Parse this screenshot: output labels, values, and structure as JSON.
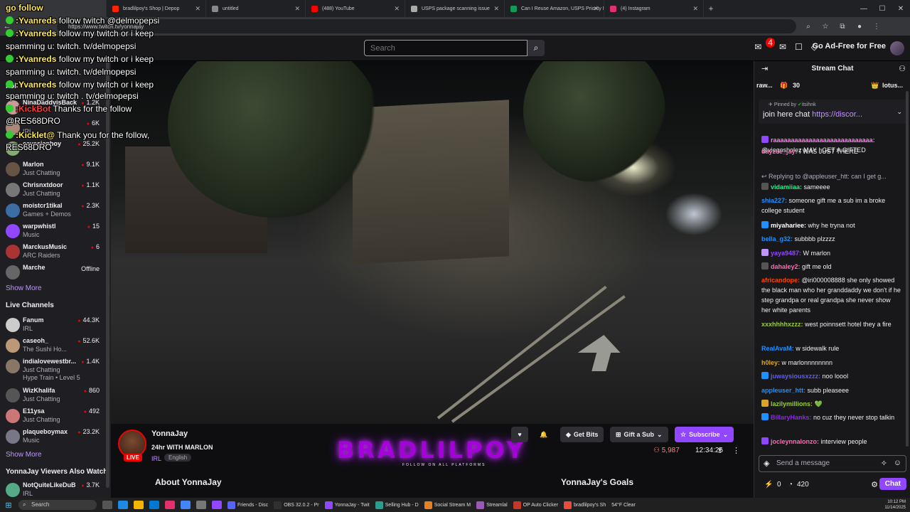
{
  "browser": {
    "tabs": [
      {
        "title": "bradlilpoy's Shop | Depop",
        "color": "#ff2300"
      },
      {
        "title": "untitled",
        "color": "#888888"
      },
      {
        "title": "(488) YouTube",
        "color": "#ff0000"
      },
      {
        "title": "USPS package scanning issue",
        "color": "#aaaaaa"
      },
      {
        "title": "Can I Reuse Amazon, USPS Priority M",
        "color": "#0f9d58"
      },
      {
        "title": "(4) Instagram",
        "color": "#e1306c"
      }
    ],
    "url": "https://www.twitch.tv/yonnajay"
  },
  "topnav": {
    "search_placeholder": "Search",
    "notif_count": "4",
    "adfree_label": "Go Ad-Free for Free"
  },
  "sidebar": {
    "followed_heading": "Fol",
    "followed": [
      {
        "name": "NinaDaddyisBack",
        "category": "",
        "count": "1.2K",
        "color": "#c99"
      },
      {
        "name": "",
        "category": "IRL",
        "count": "6K",
        "color": "#a87"
      },
      {
        "name": "cavasianboy",
        "category": "",
        "count": "25.2K",
        "color": "#8a7"
      },
      {
        "name": "Marlon",
        "category": "Just Chatting",
        "count": "9.1K",
        "color": "#654"
      },
      {
        "name": "Chrisnxtdoor",
        "category": "Just Chatting",
        "count": "1.1K",
        "color": "#777"
      },
      {
        "name": "moistcr1tikal",
        "category": "Games + Demos",
        "count": "2.3K",
        "color": "#3a6ea5"
      },
      {
        "name": "warpwhistl",
        "category": "Music",
        "count": "15",
        "color": "#9147ff"
      },
      {
        "name": "MarckusMusic",
        "category": "ARC Raiders",
        "count": "6",
        "color": "#a33"
      },
      {
        "name": "Marche",
        "category": "",
        "count": "",
        "offline": "Offline",
        "color": "#666"
      }
    ],
    "show_more_1": "Show More",
    "live_heading": "Live Channels",
    "live": [
      {
        "name": "Fanum",
        "category": "IRL",
        "count": "44.3K",
        "color": "#ccc"
      },
      {
        "name": "caseoh_",
        "category": "The Sushi Ho...",
        "count": "52.6K",
        "color": "#b97"
      },
      {
        "name": "indialovewestbr...",
        "category": "Just Chatting",
        "count": "1.4K",
        "color": "#876",
        "sub": "Hype Train • Level 5"
      },
      {
        "name": "WizKhalifa",
        "category": "Just Chatting",
        "count": "860",
        "color": "#555"
      },
      {
        "name": "E11ysa",
        "category": "Just Chatting",
        "count": "492",
        "color": "#c77"
      },
      {
        "name": "plaqueboymax",
        "category": "Music",
        "count": "23.2K",
        "color": "#778"
      }
    ],
    "show_more_2": "Show More",
    "also_watch_heading": "YonnaJay Viewers Also Watch",
    "also_watch": [
      {
        "name": "NotQuiteLikeDuB",
        "category": "IRL",
        "count": "3.7K",
        "color": "#5a8"
      }
    ]
  },
  "overlay_chat": [
    {
      "user": "go follow",
      "text": "",
      "plain": true
    },
    {
      "user": ":Yvanreds",
      "text": " follow twitch @delmopepsi"
    },
    {
      "user": ":Yvanreds",
      "text": " follow my twitch or i keep"
    },
    {
      "user": "",
      "text": "spamming u: twitch. tv/delmopepsi",
      "plain": true
    },
    {
      "user": ":Yvanreds",
      "text": " follow my twitch or i keep"
    },
    {
      "user": "",
      "text": "spamming u: twitch. tv/delmopepsi",
      "plain": true
    },
    {
      "user": ":Yvanreds",
      "text": " follow my twitch or i keep"
    },
    {
      "user": "",
      "text": "spamming u: twitch . tv/delmopepsi",
      "plain": true
    },
    {
      "user": ":KickBot",
      "text": " Thanks for the follow",
      "red": true
    },
    {
      "user": "",
      "text": "@RES68DRO",
      "plain": true
    },
    {
      "user": ":Kicklet@",
      "text": " Thank you for the follow,"
    },
    {
      "user": "",
      "text": "RES68DRO",
      "plain": true
    }
  ],
  "stream": {
    "streamer": "YonnaJay",
    "title": "24hr WITH MARLON",
    "live": "LIVE",
    "category": "IRL",
    "tag": "English",
    "watermark": "BRADLILPOY",
    "watermark_sub": "FOLLOW ON ALL PLATFORMS",
    "get_bits": "Get Bits",
    "gift_sub": "Gift a Sub",
    "subscribe": "Subscribe",
    "viewers": "5,987",
    "uptime": "12:34:26",
    "about": "About YonnaJay",
    "goals": "YonnaJay's Goals"
  },
  "chat": {
    "header": "Stream Chat",
    "gift_left_user": "raw...",
    "gift_left_count": "30",
    "gift_right_user": "lotus...",
    "pinned_by": "Pinned by",
    "pinned_by_user": "itsihnk",
    "pinned_text": "join here chat",
    "pinned_link": "https://discor...",
    "messages": [
      {
        "user": "raaaaaaaaaaaaaaaaaaaaaaaaaaaa:",
        "text": " @viegosholez MAY I GET A GIFTED",
        "color": "#ff7ff0",
        "badge": "#9147ff"
      },
      {
        "user": "dayzee_jay:",
        "text": " I WAS JUST THERE",
        "color": "#ff69b4"
      },
      {
        "user": "",
        "text": "Replying to @appleuser_htt: can I get g...",
        "color": "#adadb8",
        "reply": true
      },
      {
        "user": "vidamiiaa:",
        "text": " sameeee",
        "color": "#00ff7f",
        "badge": "#555"
      },
      {
        "user": "shia227:",
        "text": " someone gift me a sub im a broke college student",
        "color": "#1e90ff"
      },
      {
        "user": "miyahariee:",
        "text": " why he tryna not",
        "color": "#ffffff",
        "badge": "#1e90ff"
      },
      {
        "user": "bella_g32:",
        "text": " subbbb plzzzz",
        "color": "#1e90ff"
      },
      {
        "user": "yaya9487:",
        "text": " W marlon",
        "color": "#9147ff",
        "badge": "#bf94ff"
      },
      {
        "user": "dahaley2:",
        "text": " gift me old",
        "color": "#ff69b4",
        "badge": "#555"
      },
      {
        "user": "africandope:",
        "text": " @iri000008888 she only showed the black man who her granddaddy we don't if he step grandpa or real grandpa she never show her white parents",
        "color": "#ff4500"
      },
      {
        "user": "xxxhhhhxzzz:",
        "text": " west poinnsett hotel they a fire",
        "color": "#9acd32"
      },
      {
        "user": "RealAvaM:",
        "text": " w sidewalk rule",
        "color": "#1e90ff"
      },
      {
        "user": "h0ley:",
        "text": " w marlonnnnnnnn",
        "color": "#daa520"
      },
      {
        "user": "juwaysiousxzzz:",
        "text": " noo loool",
        "color": "#5a5aff",
        "badge": "#1e90ff"
      },
      {
        "user": "appleuser_htt:",
        "text": " subb pleaseee",
        "color": "#1e90ff"
      },
      {
        "user": "lazilymillions:",
        "text": " 💚",
        "color": "#9acd32",
        "badge": "#daa520"
      },
      {
        "user": "BillaryHanks:",
        "text": " no cuz they never stop talkin",
        "color": "#8a2be2",
        "badge": "#1e90ff"
      },
      {
        "user": "jocleynnalonzo:",
        "text": " interview people",
        "color": "#ff69b4",
        "badge": "#9147ff"
      }
    ],
    "input_placeholder": "Send a message",
    "points_a": "0",
    "points_b": "420",
    "chat_button": "Chat"
  },
  "taskbar": {
    "search": "Search",
    "apps": [
      "Friends - Disc",
      "OBS 32.0.2 - Pr",
      "YonnaJay - Twit",
      "Selling Hub - D",
      "Social Stream M",
      "Streamlal",
      "OP Auto Clicker",
      "bradlilpoy's Sh"
    ],
    "weather": "54°F Clear",
    "time": "10:12 PM",
    "date": "11/14/2025"
  }
}
